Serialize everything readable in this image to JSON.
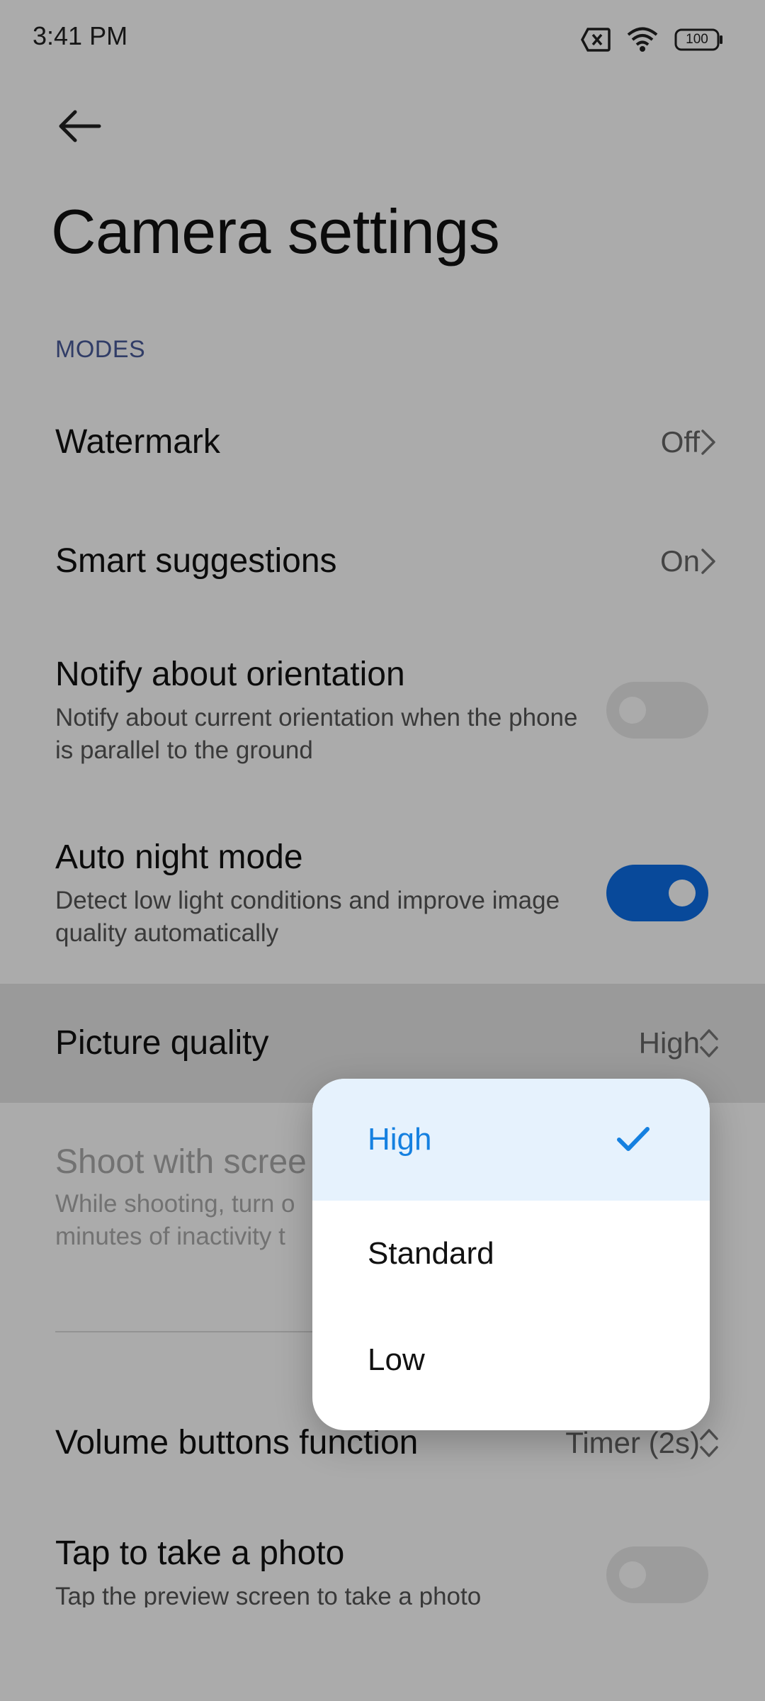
{
  "status_bar": {
    "time": "3:41 PM",
    "battery": "100",
    "icons": [
      "sim-off-icon",
      "wifi-icon",
      "battery-icon"
    ]
  },
  "header": {
    "back_icon": "arrow-left-icon",
    "title": "Camera settings"
  },
  "section": {
    "modes_label": "MODES"
  },
  "settings": {
    "watermark": {
      "title": "Watermark",
      "value": "Off"
    },
    "smart_suggestions": {
      "title": "Smart suggestions",
      "value": "On"
    },
    "notify_orientation": {
      "title": "Notify about orientation",
      "subtitle": "Notify about current orientation when the phone is parallel to the ground",
      "enabled": false
    },
    "auto_night_mode": {
      "title": "Auto night mode",
      "subtitle": "Detect low light conditions and improve image quality automatically",
      "enabled": true
    },
    "picture_quality": {
      "title": "Picture quality",
      "value": "High"
    },
    "shoot_with_screen": {
      "title": "Shoot with scree",
      "subtitle_line1": "While shooting, turn o",
      "subtitle_line2": "minutes of inactivity t"
    },
    "volume_buttons": {
      "title": "Volume buttons function",
      "value": "Timer (2s)"
    },
    "tap_to_take": {
      "title": "Tap to take a photo",
      "subtitle": "Tap the preview screen to take a photo",
      "enabled": false
    }
  },
  "picture_quality_menu": {
    "options": [
      {
        "label": "High",
        "selected": true
      },
      {
        "label": "Standard",
        "selected": false
      },
      {
        "label": "Low",
        "selected": false
      }
    ]
  },
  "colors": {
    "accent": "#0d6de6",
    "selected_text": "#1580e0",
    "selected_bg": "#e6f2fd",
    "section_header": "#4a5b9a"
  },
  "nav_bar": {
    "icons": [
      "recents-square-icon",
      "home-circle-icon",
      "back-triangle-icon"
    ]
  }
}
